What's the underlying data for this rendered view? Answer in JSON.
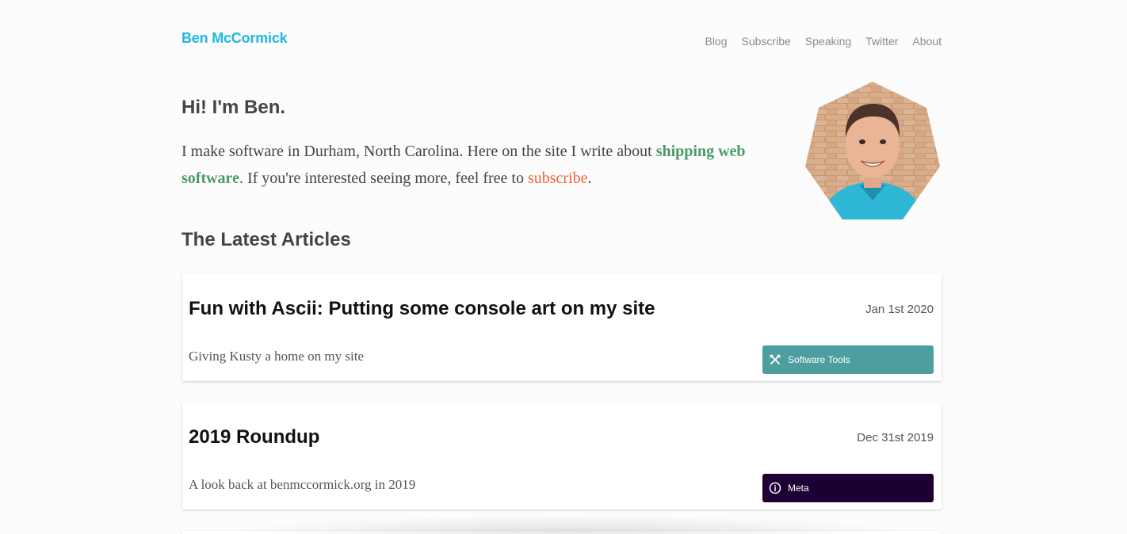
{
  "site": {
    "title": "Ben McCormick",
    "accent": "#1fb8e0"
  },
  "nav": {
    "items": [
      {
        "label": "Blog"
      },
      {
        "label": "Subscribe"
      },
      {
        "label": "Speaking"
      },
      {
        "label": "Twitter"
      },
      {
        "label": "About"
      }
    ]
  },
  "intro": {
    "heading": "Hi! I'm Ben.",
    "text_1": "I make software in Durham, North Carolina. Here on the site I write about ",
    "link_1": "shipping web software",
    "text_2": ". If you're interested seeing more, feel free to ",
    "link_2": "subscribe",
    "text_3": ".",
    "link_1_color": "#4a9a6a",
    "link_2_color": "#f0643c"
  },
  "articles": {
    "section_title": "The Latest Articles",
    "items": [
      {
        "title": "Fun with Ascii: Putting some console art on my site",
        "date": "Jan 1st 2020",
        "description": "Giving Kusty a home on my site",
        "tag": {
          "label": "Software Tools",
          "icon": "tools-icon",
          "color": "#4d9e9e"
        }
      },
      {
        "title": "2019 Roundup",
        "date": "Dec 31st 2019",
        "description": "A look back at benmccormick.org in 2019",
        "tag": {
          "label": "Meta",
          "icon": "info-icon",
          "color": "#1c0033"
        }
      }
    ]
  }
}
